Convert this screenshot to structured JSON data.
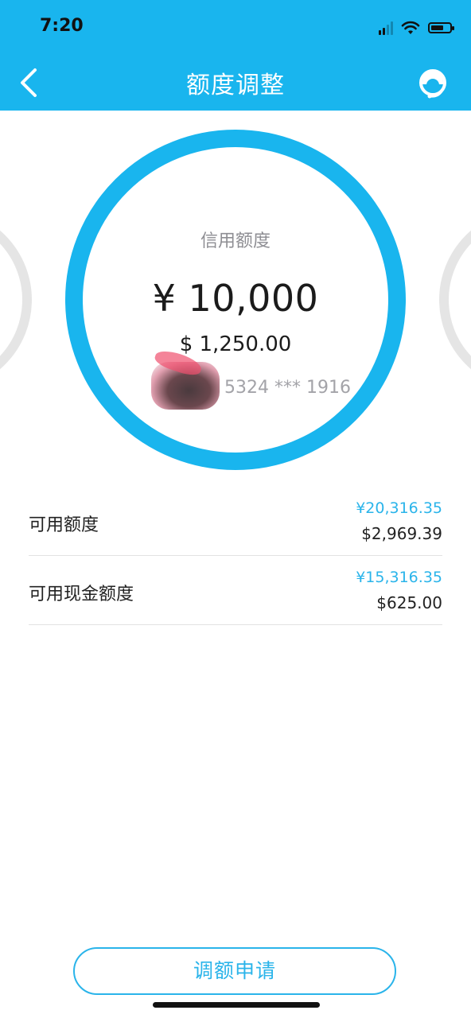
{
  "status_bar": {
    "time": "7:20",
    "signal_icon": "cellular-signal-icon",
    "wifi_icon": "wifi-icon",
    "battery_icon": "battery-icon"
  },
  "header": {
    "title": "额度调整",
    "back_icon": "chevron-left-icon",
    "service_icon": "customer-service-icon",
    "background_color": "#19b5ee"
  },
  "credit": {
    "label": "信用额度",
    "amount_cny": "¥ 10,000",
    "amount_usd": "$ 1,250.00",
    "card_number": "5324 *** 1916",
    "ring_color": "#19b5ee"
  },
  "limits": [
    {
      "label": "可用额度",
      "amount_cny": "¥20,316.35",
      "amount_usd": "$2,969.39"
    },
    {
      "label": "可用现金额度",
      "amount_cny": "¥15,316.35",
      "amount_usd": "$625.00"
    }
  ],
  "apply_button": {
    "label": "调额申请",
    "color": "#2ab4ea"
  }
}
